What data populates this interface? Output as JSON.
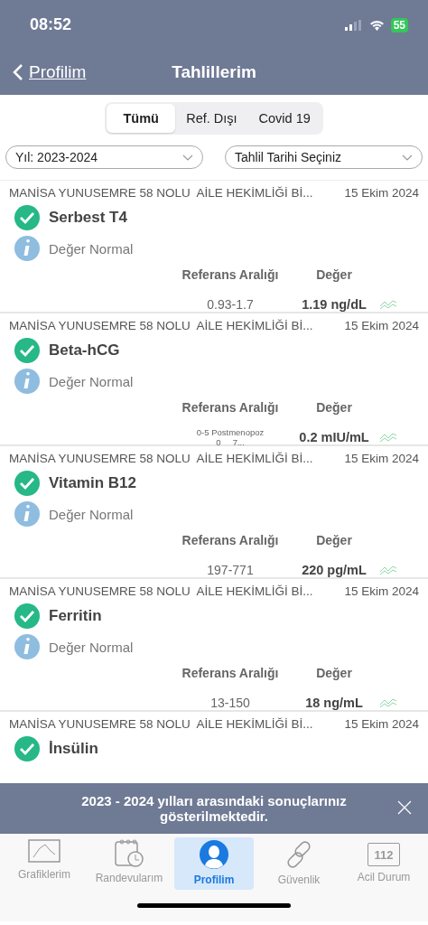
{
  "status_bar": {
    "time": "08:52",
    "battery": "55"
  },
  "nav": {
    "back": "Profilim",
    "title": "Tahlillerim"
  },
  "segments": [
    {
      "label": "Tümü",
      "selected": true
    },
    {
      "label": "Ref. Dışı",
      "selected": false
    },
    {
      "label": "Covid 19",
      "selected": false
    }
  ],
  "filters": [
    {
      "value": "Yıl: 2023-2024"
    },
    {
      "value": "Tahlil Tarihi Seçiniz"
    }
  ],
  "results": [
    {
      "facility": "MANİSA YUNUSEMRE 58 NOLU  AİLE HEKİMLİĞİ Bİ...",
      "date": "15 Ekim 2024",
      "name": "Serbest T4",
      "normal": true,
      "status": "Değer Normal",
      "reference_label": "Referans Aralığı",
      "value_label": "Değer",
      "reference": "0.93-1.7",
      "value": "1.19 ng/dL"
    },
    {
      "facility": "MANİSA YUNUSEMRE 58 NOLU  AİLE HEKİMLİĞİ Bİ...",
      "date": "15 Ekim 2024",
      "name": "Beta-hCG",
      "normal": true,
      "status": "Değer Normal",
      "reference_label": "Referans Aralığı",
      "value_label": "Değer",
      "reference": "0-5 Postmenopoz\n0     7...",
      "value": "0.2 mIU/mL"
    },
    {
      "facility": "MANİSA YUNUSEMRE 58 NOLU  AİLE HEKİMLİĞİ Bİ...",
      "date": "15 Ekim 2024",
      "name": "Vitamin B12",
      "normal": true,
      "status": "Değer Normal",
      "reference_label": "Referans Aralığı",
      "value_label": "Değer",
      "reference": "197-771",
      "value": "220 pg/mL"
    },
    {
      "facility": "MANİSA YUNUSEMRE 58 NOLU  AİLE HEKİMLİĞİ Bİ...",
      "date": "15 Ekim 2024",
      "name": "Ferritin",
      "normal": true,
      "status": "Değer Normal",
      "reference_label": "Referans Aralığı",
      "value_label": "Değer",
      "reference": "13-150",
      "value": "18 ng/mL"
    },
    {
      "facility": "MANİSA YUNUSEMRE 58 NOLU  AİLE HEKİMLİĞİ Bİ...",
      "date": "15 Ekim 2024",
      "name": "İnsülin",
      "normal": true
    }
  ],
  "toast": {
    "message": "2023 - 2024 yılları arasındaki sonuçlarınız gösterilmektedir."
  },
  "tab_bar": [
    {
      "kind": "chart",
      "label": "Grafiklerim",
      "selected": false
    },
    {
      "kind": "calendar",
      "label": "Randevularım",
      "selected": false
    },
    {
      "kind": "profile",
      "label": "Profilim",
      "selected": true
    },
    {
      "kind": "link",
      "label": "Güvenlik",
      "selected": false
    },
    {
      "kind": "emergency",
      "label": "Acil Durum",
      "badge": "112",
      "selected": false
    }
  ]
}
